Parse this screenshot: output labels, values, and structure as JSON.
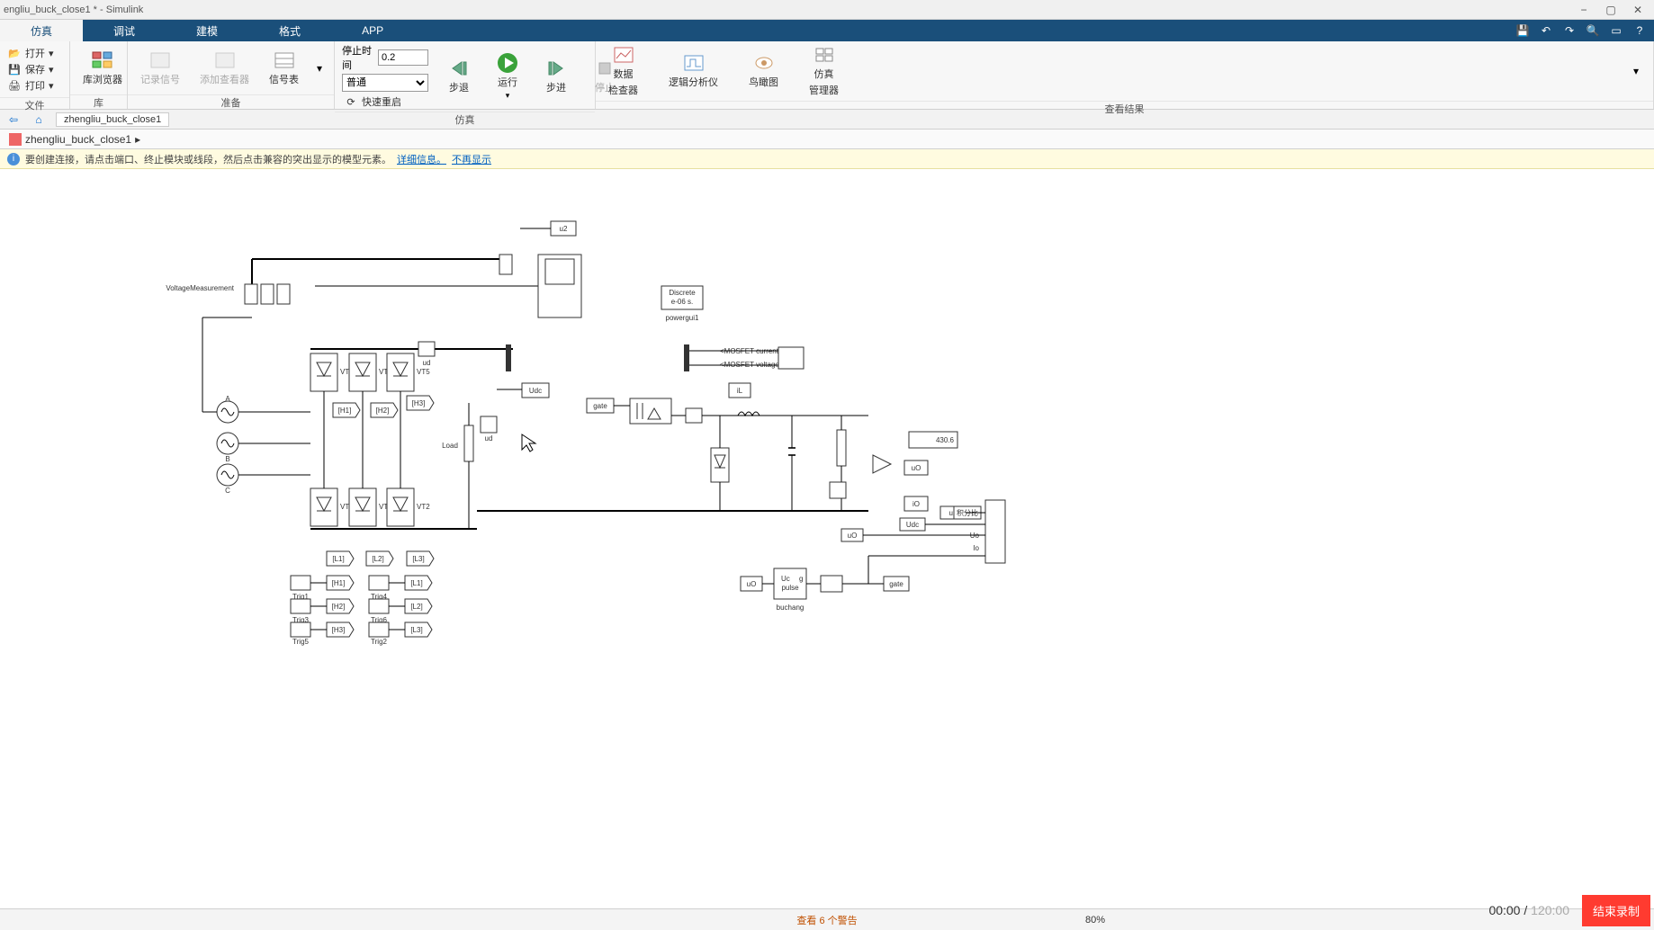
{
  "titlebar": {
    "title": "engliu_buck_close1 * - Simulink"
  },
  "maintabs": {
    "items": [
      "仿真",
      "调试",
      "建模",
      "格式",
      "APP"
    ],
    "active_index": 0
  },
  "toolstrip": {
    "file": {
      "open": "打开",
      "save": "保存",
      "print": "打印",
      "group_label": "文件"
    },
    "library": {
      "btn": "库浏览器",
      "group_label": "库"
    },
    "prepare": {
      "log_signal": "记录信号",
      "add_viewer": "添加查看器",
      "signal_table": "信号表",
      "group_label": "准备"
    },
    "sim": {
      "stop_time_label": "停止时间",
      "stop_time_value": "0.2",
      "mode": "普通",
      "fast_restart": "快速重启",
      "step_back": "步退",
      "run": "运行",
      "step_fwd": "步进",
      "stop": "停止",
      "group_label": "仿真"
    },
    "results": {
      "data_inspector_l1": "数据",
      "data_inspector_l2": "检查器",
      "logic_analyzer": "逻辑分析仪",
      "bird_eye": "鸟瞰图",
      "sim_mgr_l1": "仿真",
      "sim_mgr_l2": "管理器",
      "group_label": "查看结果"
    }
  },
  "nav": {
    "path": "zhengliu_buck_close1"
  },
  "modeltab": {
    "name": "zhengliu_buck_close1"
  },
  "banner": {
    "text": "要创建连接，请点击端口、终止模块或线段，然后点击兼容的突出显示的模型元素。",
    "link1": "详细信息。",
    "link2": "不再显示"
  },
  "canvas": {
    "labels": {
      "voltage_measurement": "Voltage\nMeasurement",
      "vt1": "VT1",
      "vt3": "VT3",
      "vt5": "VT5",
      "vt4": "VT4",
      "vt6": "VT6",
      "vt2": "VT2",
      "h1": "[H1]",
      "h2": "[H2]",
      "h3": "[H3]",
      "l1": "[L1]",
      "l2": "[L2]",
      "l3": "[L3]",
      "trig1": "Trig1",
      "trig3": "Trig3",
      "trig5": "Trig5",
      "trig4": "Trig4",
      "trig6": "Trig6",
      "trig2": "Trig2",
      "A": "A",
      "B": "B",
      "C": "C",
      "load": "Load",
      "ud_goto": "ud",
      "udc_goto": "Udc",
      "u2_goto": "u2",
      "powergui_l1": "Discrete",
      "powergui_l2": "e-06 s.",
      "powergui_name": "powergui1",
      "mosfet_i": "<MOSFET current>",
      "mosfet_v": "<MOSFET voltage>",
      "gate": "gate",
      "iL": "iL",
      "display_val": "430.6",
      "uO": "uO",
      "iO": "iO",
      "u2_2": "u2",
      "Udc2": "Udc",
      "Uo": "Uo",
      "Io": "Io",
      "subsystem": "积分比",
      "buchang": "buchang",
      "pulse": "pulse",
      "Uc": "Uc",
      "g": "g"
    }
  },
  "status": {
    "warn": "查看 6 个警告",
    "zoom": "80%"
  },
  "recorder": {
    "time": "00:00",
    "duration": "120:00",
    "end": "结束录制"
  },
  "colors": {
    "tabbg": "#1a4f7a",
    "run": "#3aa23a",
    "warn": "#c05000",
    "record": "#ff3b30"
  }
}
